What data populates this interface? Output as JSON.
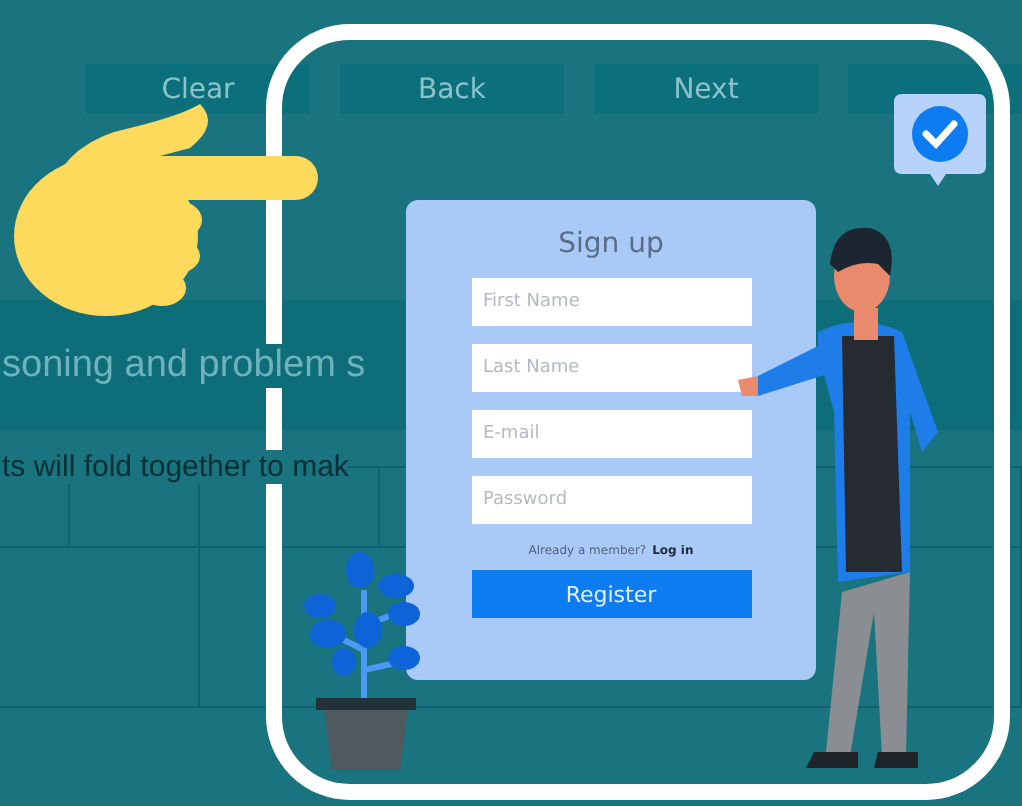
{
  "toolbar_buttons": [
    {
      "label": "Clear"
    },
    {
      "label": "Back"
    },
    {
      "label": "Next"
    }
  ],
  "heading_band": {
    "text": "soning and problem s"
  },
  "instruction": "ts will fold together to mak",
  "signup_form": {
    "title": "Sign up",
    "fields": [
      {
        "placeholder": "First Name"
      },
      {
        "placeholder": "Last Name"
      },
      {
        "placeholder": "E-mail"
      },
      {
        "placeholder": "Password"
      }
    ],
    "member_prompt": "Already a member?",
    "login_link": "Log in",
    "register_button": "Register"
  }
}
